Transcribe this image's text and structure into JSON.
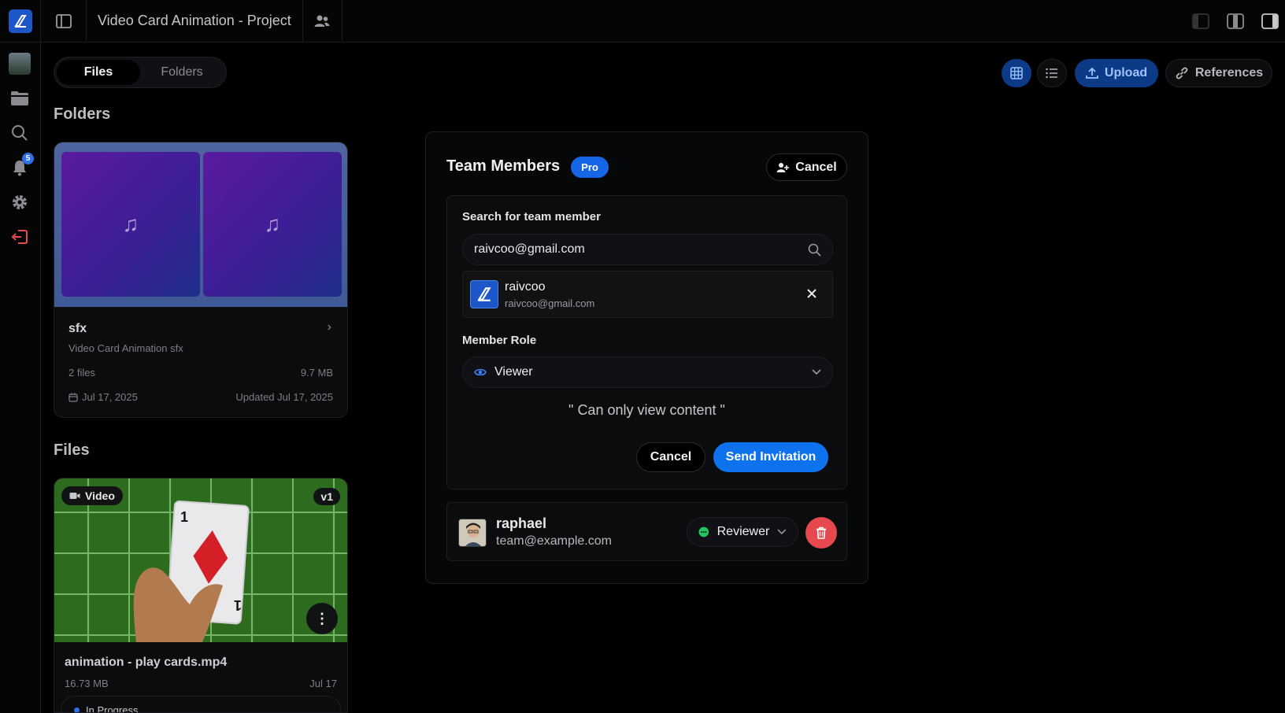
{
  "topbar": {
    "project_title": "Video Card Animation - Project"
  },
  "sidebar": {
    "notification_count": "5"
  },
  "tabs": {
    "files": "Files",
    "folders": "Folders"
  },
  "toolbar": {
    "upload_label": "Upload",
    "references_label": "References"
  },
  "sections": {
    "folders_heading": "Folders",
    "files_heading": "Files"
  },
  "folder": {
    "name": "sfx",
    "description": "Video Card Animation sfx",
    "file_count": "2 files",
    "size": "9.7 MB",
    "created": "Jul 17, 2025",
    "updated": "Updated Jul 17, 2025",
    "tile_icons": [
      "♫",
      "♫"
    ]
  },
  "file": {
    "type_label": "Video",
    "version": "v1",
    "name": "animation - play cards.mp4",
    "size": "16.73 MB",
    "date": "Jul 17",
    "status": "In Progress",
    "card_rank": "1",
    "status_color": "#2f6fe8"
  },
  "modal": {
    "title": "Team Members",
    "badge": "Pro",
    "cancel_top": "Cancel",
    "search_label": "Search for team member",
    "search_value": "raivcoo@gmail.com",
    "result": {
      "name": "raivcoo",
      "email": "raivcoo@gmail.com"
    },
    "role_label": "Member Role",
    "role_value": "Viewer",
    "role_description": "\" Can only view content \"",
    "cancel_button": "Cancel",
    "send_button": "Send Invitation",
    "member": {
      "name": "raphael",
      "email": "team@example.com",
      "role": "Reviewer"
    }
  },
  "colors": {
    "accent": "#0e72ee",
    "danger": "#e5484d",
    "pro_badge": "#1766e8"
  }
}
